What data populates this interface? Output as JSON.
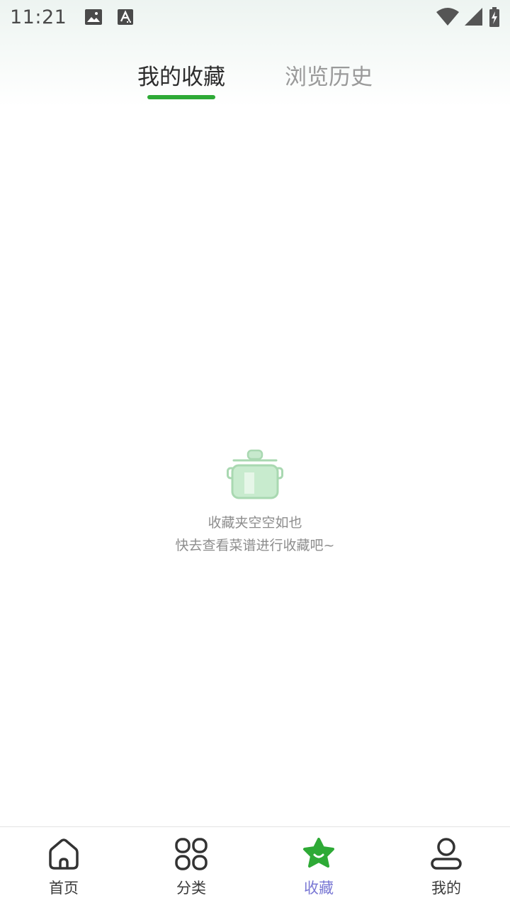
{
  "status_bar": {
    "time": "11:21",
    "notification_icons": [
      "image-icon",
      "text-a-icon"
    ],
    "system_icons": [
      "wifi-icon",
      "signal-icon",
      "battery-charging-icon"
    ]
  },
  "tabs": [
    {
      "label": "我的收藏",
      "active": true
    },
    {
      "label": "浏览历史",
      "active": false
    }
  ],
  "empty_state": {
    "icon": "cooking-pot-icon",
    "title": "收藏夹空空如也",
    "subtitle": "快去查看菜谱进行收藏吧~"
  },
  "bottom_nav": [
    {
      "label": "首页",
      "icon": "home-icon",
      "active": false
    },
    {
      "label": "分类",
      "icon": "grid-icon",
      "active": false
    },
    {
      "label": "收藏",
      "icon": "star-icon",
      "active": true
    },
    {
      "label": "我的",
      "icon": "user-icon",
      "active": false
    }
  ],
  "colors": {
    "accent_green": "#2eaa36",
    "active_nav_label": "#7a78d4",
    "muted_text": "#8d8d8d"
  }
}
